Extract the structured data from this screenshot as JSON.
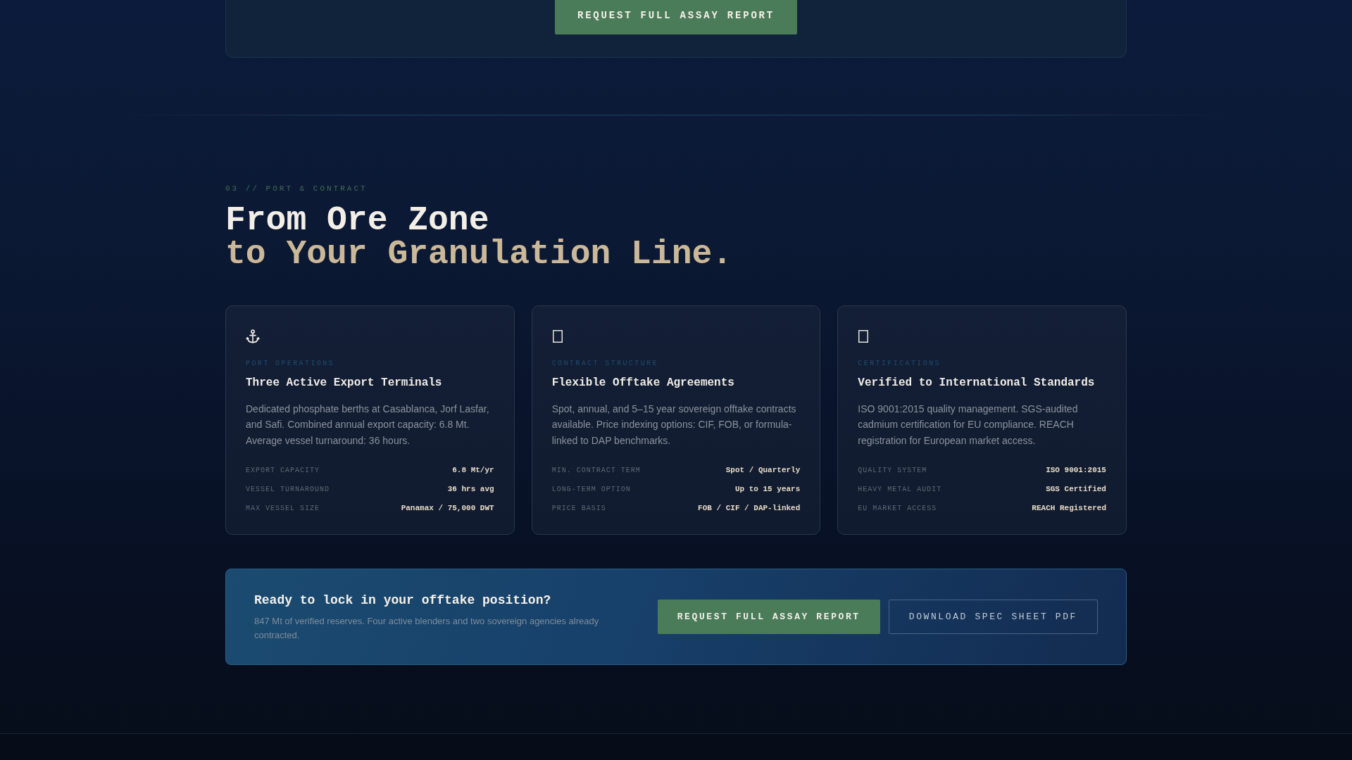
{
  "top_panel": {
    "button": "REQUEST FULL ASSAY REPORT"
  },
  "section": {
    "eyebrow": "03 // PORT & CONTRACT",
    "heading_line_1": "From Ore Zone",
    "heading_line_2": "to Your Granulation Line."
  },
  "cards": [
    {
      "kind": "anchor",
      "category": "PORT OPERATIONS",
      "title": "Three Active Export Terminals",
      "description": "Dedicated phosphate berths at Casablanca, Jorf Lasfar, and Safi. Combined annual export capacity: 6.8 Mt. Average vessel turnaround: 36 hours.",
      "specs": [
        {
          "label": "EXPORT CAPACITY",
          "value": "6.8 Mt/yr"
        },
        {
          "label": "VESSEL TURNAROUND",
          "value": "36 hrs avg"
        },
        {
          "label": "MAX VESSEL SIZE",
          "value": "Panamax / 75,000 DWT"
        }
      ]
    },
    {
      "kind": "blank",
      "category": "CONTRACT STRUCTURE",
      "title": "Flexible Offtake Agreements",
      "description": "Spot, annual, and 5–15 year sovereign offtake contracts available. Price indexing options: CIF, FOB, or formula-linked to DAP benchmarks.",
      "specs": [
        {
          "label": "MIN. CONTRACT TERM",
          "value": "Spot / Quarterly"
        },
        {
          "label": "LONG-TERM OPTION",
          "value": "Up to 15 years"
        },
        {
          "label": "PRICE BASIS",
          "value": "FOB / CIF / DAP-linked"
        }
      ]
    },
    {
      "kind": "blank",
      "category": "CERTIFICATIONS",
      "title": "Verified to International Standards",
      "description": "ISO 9001:2015 quality management. SGS-audited cadmium certification for EU compliance. REACH registration for European market access.",
      "specs": [
        {
          "label": "QUALITY SYSTEM",
          "value": "ISO 9001:2015"
        },
        {
          "label": "HEAVY METAL AUDIT",
          "value": "SGS Certified"
        },
        {
          "label": "EU MARKET ACCESS",
          "value": "REACH Registered"
        }
      ]
    }
  ],
  "cta": {
    "title": "Ready to lock in your offtake position?",
    "text": "847 Mt of verified reserves. Four active blenders and two sovereign agencies already contracted.",
    "buttons": [
      {
        "kind": "primary",
        "label": "REQUEST FULL ASSAY REPORT"
      },
      {
        "kind": "outline",
        "label": "DOWNLOAD SPEC SHEET PDF"
      }
    ]
  }
}
